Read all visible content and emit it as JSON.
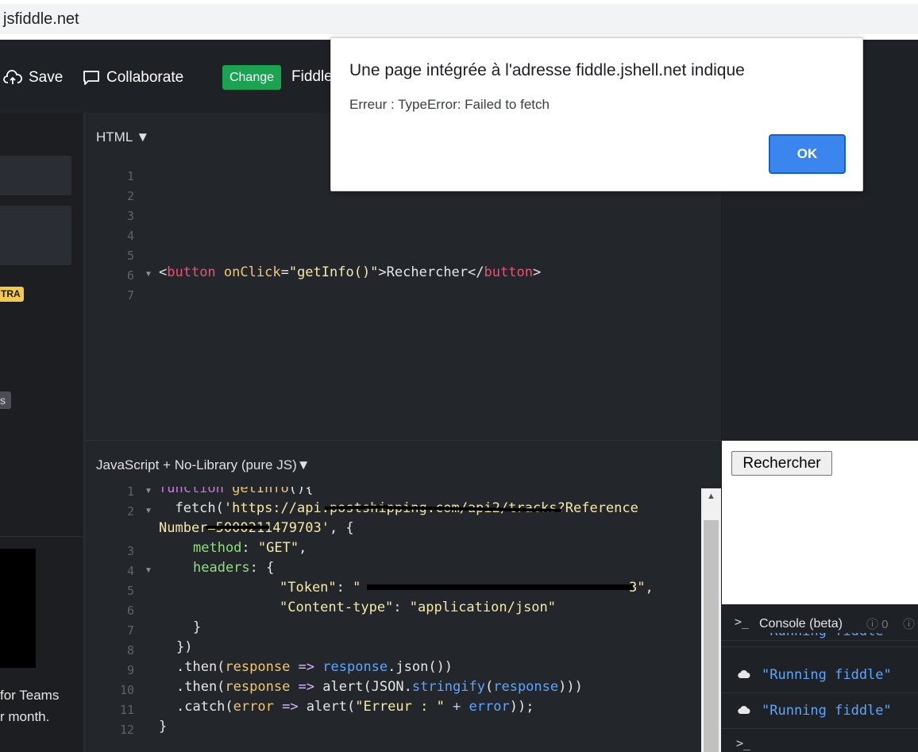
{
  "browser": {
    "url": "jsfiddle.net"
  },
  "toolbar": {
    "save_label": "Save",
    "collaborate_label": "Collaborate",
    "change_label": "Change",
    "fiddle_label": "Fiddle"
  },
  "sidebar": {
    "badge_extra": "TRA",
    "badge_s": "s",
    "teams_text": "for Teams",
    "month_text": "r month."
  },
  "html_panel": {
    "label": "HTML",
    "line_numbers": [
      "1",
      "2",
      "3",
      "4",
      "5",
      "6",
      "7"
    ],
    "code": {
      "open_bracket": "<",
      "tag": "button",
      "attr": "onClick",
      "eq": "=",
      "value": "\"getInfo()\"",
      "close_open": ">",
      "text": "Rechercher",
      "end_open": "</",
      "end_tag": "button",
      "end_close": ">"
    }
  },
  "js_panel": {
    "label": "JavaScript + No-Library (pure JS)",
    "line_numbers": [
      "1",
      "2",
      "",
      "3",
      "4",
      "5",
      "6",
      "7",
      "8",
      "9",
      "10",
      "11",
      "12"
    ],
    "lines": {
      "l1_kw": "function",
      "l1_fn": "getInfo",
      "l1_rest": "(){",
      "l2_pre": "  fetch(",
      "l2_str": "'https://api.postshipping.com/api2/tracks?Reference",
      "l2b_str": "Number=5000211479703'",
      "l2b_rest": ", {",
      "l3_key": "method",
      "l3_colon": ": ",
      "l3_val": "\"GET\"",
      "l3_comma": ",",
      "l4_key": "headers",
      "l4_rest": ": {",
      "l5_key": "\"Token\"",
      "l5_colon": ": ",
      "l5_val": "\"",
      "l5_end": "3\",",
      "l6_key": "\"Content-type\"",
      "l6_colon": ": ",
      "l6_val": "\"application/json\"",
      "l7": "}",
      "l8": "})",
      "l9_a": ".then(",
      "l9_p": "response",
      "l9_arrow": " => ",
      "l9_b": "response",
      "l9_c": ".json())",
      "l10_a": ".then(",
      "l10_p": "response",
      "l10_arrow": " => ",
      "l10_b": "alert(JSON.",
      "l10_c": "stringify",
      "l10_d": "(",
      "l10_e": "response",
      "l10_f": ")))",
      "l11_a": ".catch(",
      "l11_p": "error",
      "l11_arrow": " => ",
      "l11_b": "alert(",
      "l11_str": "\"Erreur : \"",
      "l11_plus": " + ",
      "l11_e": "error",
      "l11_end": "));",
      "l12": "}"
    }
  },
  "result": {
    "button_label": "Rechercher"
  },
  "console": {
    "title": "Console (beta)",
    "prompt": ">_",
    "count": "0",
    "messages": [
      "\"Running fiddle\"",
      "\"Running fiddle\"",
      "\"Running fiddle\""
    ]
  },
  "dialog": {
    "title": "Une page intégrée à l'adresse fiddle.jshell.net indique",
    "message": "Erreur : TypeError: Failed to fetch",
    "ok_label": "OK",
    "ok_color": "#3b86ee"
  },
  "colors": {
    "change_button": "#1aa350",
    "tag": "#f0506e",
    "attr": "#f0c674",
    "string": "#f5e9a6",
    "key": "#8fe07a",
    "blue": "#5aa7ff"
  }
}
